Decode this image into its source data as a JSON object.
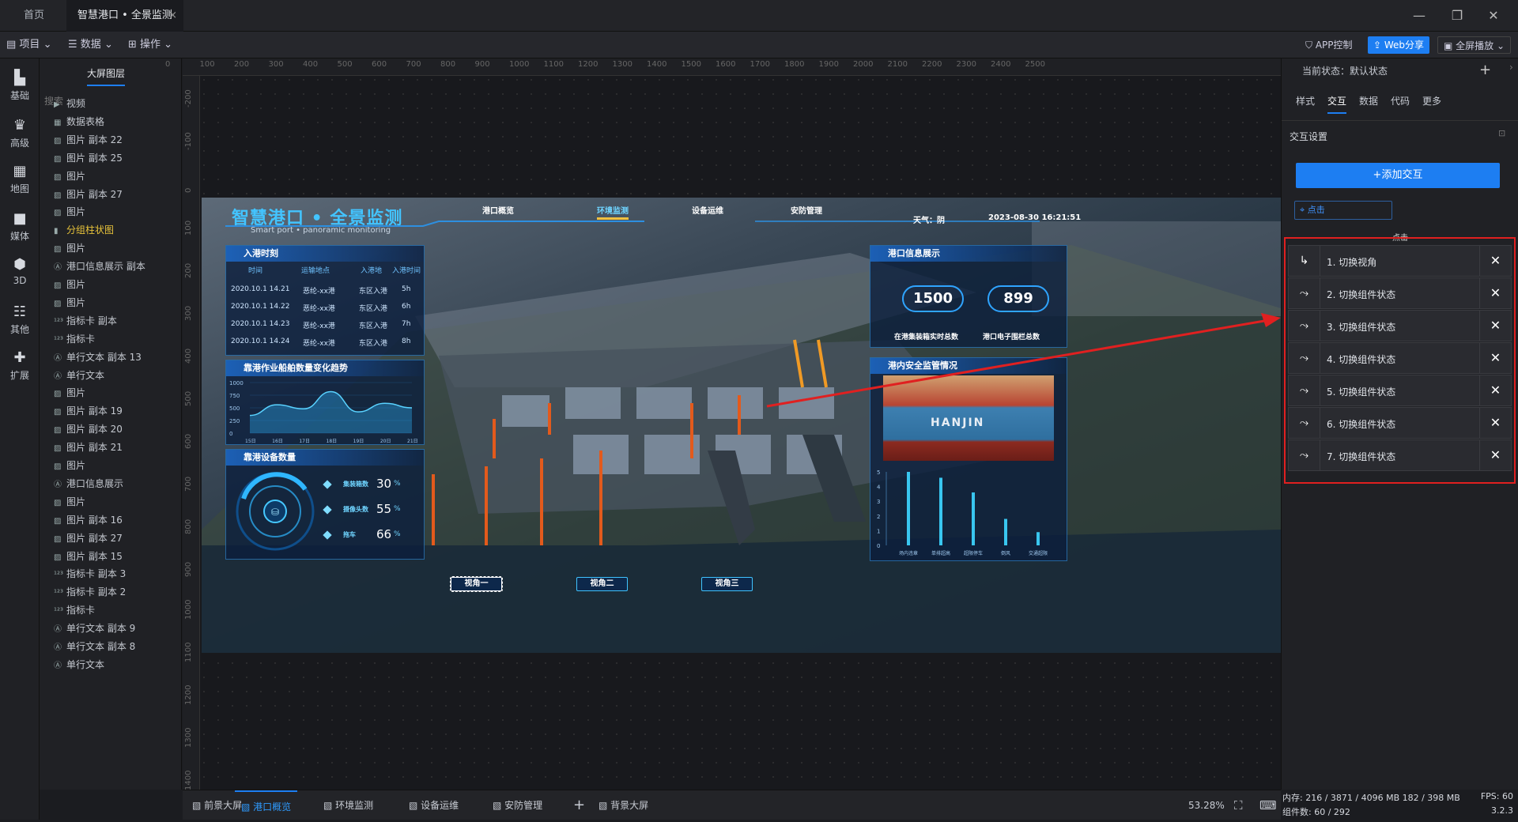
{
  "titlebar": {
    "tab_home": "首页",
    "tab_active": "智慧港口 • 全景监测",
    "close_glyph": "×"
  },
  "menubar": {
    "project": "项目",
    "data": "数据",
    "operate": "操作",
    "app_control": "APP控制",
    "web_share": "Web分享",
    "fullscreen": "全屏播放"
  },
  "rail": [
    {
      "icon": "bar-chart-icon",
      "label": "基础"
    },
    {
      "icon": "crown-icon",
      "label": "高级"
    },
    {
      "icon": "map-icon",
      "label": "地图"
    },
    {
      "icon": "media-icon",
      "label": "媒体"
    },
    {
      "icon": "cube-icon",
      "label": "3D"
    },
    {
      "icon": "list-icon",
      "label": "其他"
    },
    {
      "icon": "puzzle-icon",
      "label": "扩展"
    }
  ],
  "layers": {
    "tab": "大屏图层",
    "search_placeholder": "搜索",
    "items": [
      "视频",
      "数据表格",
      "图片 副本 22",
      "图片 副本 25",
      "图片",
      "图片 副本 27",
      "图片",
      "分组柱状图",
      "图片",
      "港口信息展示 副本",
      "图片",
      "图片",
      "指标卡 副本",
      "指标卡",
      "单行文本 副本 13",
      "单行文本",
      "图片",
      "图片 副本 19",
      "图片 副本 20",
      "图片 副本 21",
      "图片",
      "港口信息展示",
      "图片",
      "图片 副本 16",
      "图片 副本 27",
      "图片 副本 15",
      "指标卡 副本 3",
      "指标卡 副本 2",
      "指标卡",
      "单行文本 副本 9",
      "单行文本 副本 8",
      "单行文本"
    ]
  },
  "ruler_h": [
    "0",
    "100",
    "200",
    "300",
    "400",
    "500",
    "600",
    "700",
    "800",
    "900",
    "1000",
    "1100",
    "1200",
    "1300",
    "1400",
    "1500",
    "1600",
    "1700",
    "1800",
    "1900",
    "2000",
    "2100",
    "2200",
    "2300",
    "2400",
    "2500"
  ],
  "ruler_v": [
    "-200",
    "-100",
    "0",
    "100",
    "200",
    "300",
    "400",
    "500",
    "600",
    "700",
    "800",
    "900",
    "1000",
    "1100",
    "1200",
    "1300",
    "1400"
  ],
  "dashboard": {
    "title": "智慧港口 • 全景监测",
    "subtitle": "Smart port • panoramic monitoring",
    "nav": [
      "港口概览",
      "环境监测",
      "设备运维",
      "安防管理"
    ],
    "weather": "天气：阴",
    "datetime": "2023-08-30 16:21:51",
    "arrival": {
      "title": "入港时刻",
      "headers": [
        "时间",
        "运输地点",
        "入港地",
        "入港时间"
      ],
      "rows": [
        [
          "2020.10.1  14.21",
          "恶纶-xx港",
          "东区入港",
          "5h"
        ],
        [
          "2020.10.1  14.22",
          "恶纶-xx港",
          "东区入港",
          "6h"
        ],
        [
          "2020.10.1  14.23",
          "恶纶-xx港",
          "东区入港",
          "7h"
        ],
        [
          "2020.10.1  14.24",
          "恶纶-xx港",
          "东区入港",
          "8h"
        ]
      ]
    },
    "trend": {
      "title": "靠港作业船舶数量变化趋势",
      "yticks": [
        "1000",
        "750",
        "500",
        "250",
        "0"
      ],
      "xticks": [
        "15日",
        "16日",
        "17日",
        "18日",
        "19日",
        "20日",
        "21日"
      ]
    },
    "equip": {
      "title": "靠港设备数量",
      "items": [
        {
          "label": "集装箱数",
          "value": "30",
          "unit": "%"
        },
        {
          "label": "摄像头数",
          "value": "55",
          "unit": "%"
        },
        {
          "label": "拖车",
          "value": "66",
          "unit": "%"
        }
      ]
    },
    "info": {
      "title": "港口信息展示",
      "k1": "1500",
      "k1_label": "在港集装箱实时总数",
      "k2": "899",
      "k2_label": "港口电子围栏总数"
    },
    "safety": {
      "title": "港内安全监管情况",
      "ship_text": "HANJIN",
      "yticks": [
        "5",
        "4",
        "3",
        "2",
        "1",
        "0"
      ],
      "xlabels": [
        "场内违章",
        "单排超高",
        "超限停车",
        "倒风",
        "交通超限"
      ]
    },
    "views": [
      "视角一",
      "视角二",
      "视角三"
    ]
  },
  "chart_data": [
    {
      "type": "area",
      "title": "靠港作业船舶数量变化趋势",
      "x": [
        "15日",
        "16日",
        "17日",
        "18日",
        "19日",
        "20日",
        "21日"
      ],
      "values": [
        350,
        560,
        480,
        820,
        420,
        590,
        500
      ],
      "ylim": [
        0,
        1000
      ]
    },
    {
      "type": "bar",
      "title": "港内安全监管情况",
      "categories": [
        "场内违章",
        "单排超高",
        "超限停车",
        "倒风",
        "交通超限"
      ],
      "values": [
        5,
        4.6,
        3.6,
        1.8,
        0.9
      ],
      "ylim": [
        0,
        5
      ]
    }
  ],
  "right": {
    "state_label": "当前状态：默认状态",
    "tabs": [
      "样式",
      "交互",
      "数据",
      "代码",
      "更多"
    ],
    "section": "交互设置",
    "add_btn": "+添加交互",
    "trigger": "点击",
    "group_label": "点击",
    "interactions": [
      "1. 切换视角",
      "2. 切换组件状态",
      "3. 切换组件状态",
      "4. 切换组件状态",
      "5. 切换组件状态",
      "6. 切换组件状态",
      "7. 切换组件状态"
    ]
  },
  "bottom": {
    "tabs": [
      "前景大屏",
      "港口概览",
      "环境监测",
      "设备运维",
      "安防管理",
      "背景大屏"
    ],
    "zoom": "53.28%"
  },
  "status": {
    "memory": "内存: 216 / 3871 / 4096 MB  182 / 398 MB",
    "fps": "FPS: 60",
    "components": "组件数: 60 / 292",
    "version": "3.2.3"
  },
  "colors": {
    "accent": "#1d7ef2",
    "highlight": "#e02020",
    "dash_cyan": "#3fd0ff"
  }
}
